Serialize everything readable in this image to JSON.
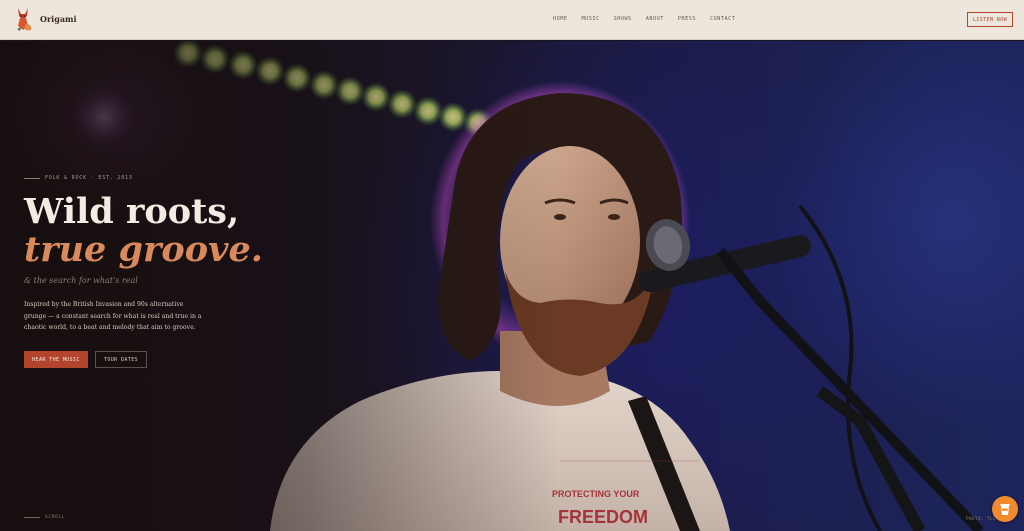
{
  "header": {
    "logo_text": "Origami",
    "nav": [
      "HOME",
      "MUSIC",
      "SHOWS",
      "ABOUT",
      "PRESS",
      "CONTACT"
    ],
    "cta_label": "LISTEN NOW"
  },
  "hero": {
    "eyebrow": "FOLK & ROCK · EST. 2013",
    "headline_line1": "Wild roots,",
    "headline_line2": "true groove.",
    "tagline": "& the search for what's real",
    "description": "Inspired by the British Invasion and 90s alternative grunge — a constant search for what is real and true in a chaotic world, to a beat and melody that aim to groove.",
    "primary_cta": "HEAR THE MUSIC",
    "secondary_cta": "TOUR DATES",
    "scroll_label": "SCROLL",
    "photo_credit": "PHOTO: TLC",
    "tshirt_text": "PROTECTING YOUR FREEDOM"
  },
  "colors": {
    "accent": "#b2452c",
    "headline_accent": "#d98a5c",
    "header_bg": "#ece6dc",
    "floating_button": "#f08a2c"
  },
  "icons": {
    "logo": "fox-icon",
    "floating_button": "coffee-cup-icon"
  }
}
